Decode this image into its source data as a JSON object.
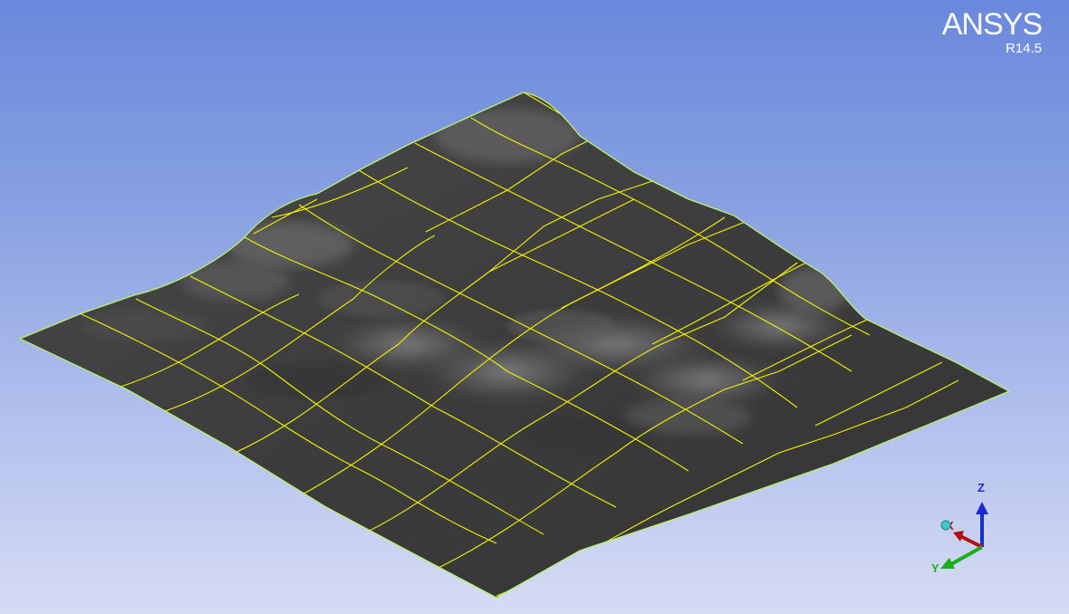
{
  "branding": {
    "product": "ANSYS",
    "release": "R14.5"
  },
  "triad": {
    "z_label": "Z",
    "x_label": "X",
    "y_label": "Y",
    "z_color": "#1a2bd0",
    "x_color": "#b01010",
    "y_color": "#18b018"
  },
  "colors": {
    "mesh_lines": "#f2f200",
    "surface_edge": "#b8f070",
    "surface_dark": "#3b3b3b",
    "surface_light": "#8c8c8c"
  }
}
